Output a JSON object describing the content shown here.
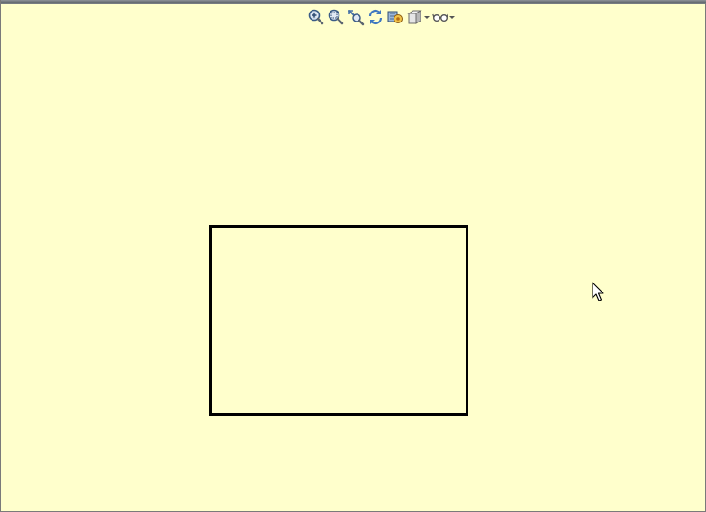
{
  "graphics_area": {
    "background_color": "#FFFFCC"
  },
  "heads_up_toolbar": {
    "tools": [
      {
        "icon": "zoom-to-fit-icon",
        "has_dropdown": false
      },
      {
        "icon": "zoom-to-area-icon",
        "has_dropdown": false
      },
      {
        "icon": "previous-view-icon",
        "has_dropdown": false
      },
      {
        "icon": "rotate-view-icon",
        "has_dropdown": false
      },
      {
        "icon": "display-style-icon",
        "has_dropdown": false
      },
      {
        "icon": "view-orientation-icon",
        "has_dropdown": true
      },
      {
        "icon": "hide-show-items-icon",
        "has_dropdown": true
      }
    ]
  },
  "sketch": {
    "shape": "rectangle",
    "line_color": "#000000"
  },
  "cursor": {
    "icon": "arrow-pointer-icon"
  }
}
